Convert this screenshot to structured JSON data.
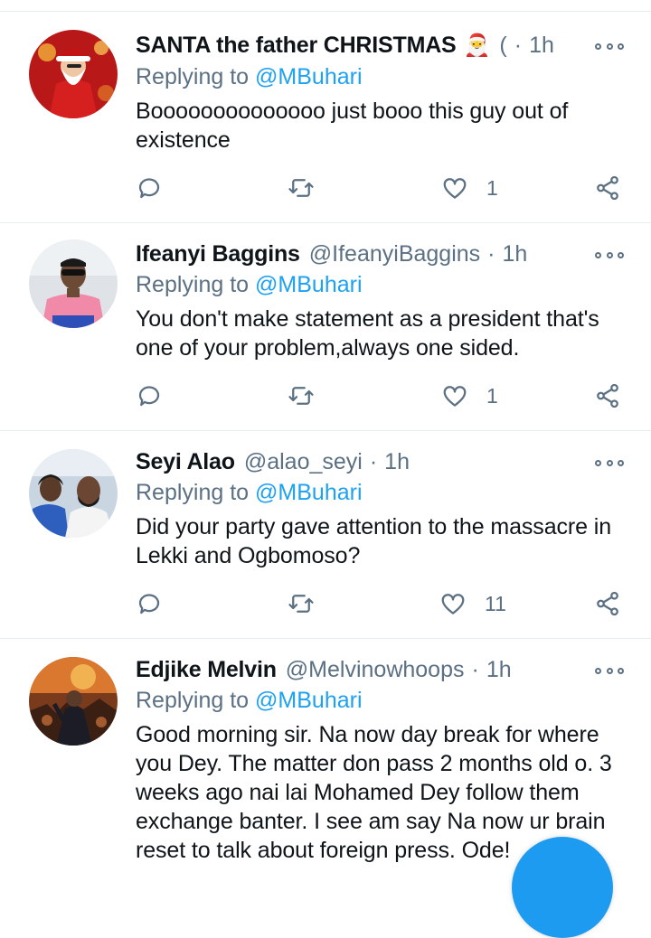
{
  "colors": {
    "accent": "#1da1f2",
    "secondary_text": "#5b7083",
    "divider": "#e6ecf0"
  },
  "replies": [
    {
      "name": "SANTA the father CHRISTMAS",
      "emoji": "🎅",
      "handle": "(",
      "time": "1h",
      "replying_prefix": "Replying to",
      "replying_to": "@MBuhari",
      "text": "Boooooooooooooo just booo this guy out of existence",
      "like_count": "1",
      "avatar_icon": "santa-avatar"
    },
    {
      "name": "Ifeanyi Baggins",
      "emoji": "",
      "handle": "@IfeanyiBaggins",
      "time": "1h",
      "replying_prefix": "Replying to",
      "replying_to": "@MBuhari",
      "text": "You don't make statement as a president that's one of your problem,always one sided.",
      "like_count": "1",
      "avatar_icon": "man-pink-shirt-avatar"
    },
    {
      "name": "Seyi Alao",
      "emoji": "",
      "handle": "@alao_seyi",
      "time": "1h",
      "replying_prefix": "Replying to",
      "replying_to": "@MBuhari",
      "text": "Did your party gave attention to the massacre in Lekki and Ogbomoso?",
      "like_count": "11",
      "avatar_icon": "couple-avatar"
    },
    {
      "name": "Edjike Melvin",
      "emoji": "",
      "handle": "@Melvinowhoops",
      "time": "1h",
      "replying_prefix": "Replying to",
      "replying_to": "@MBuhari",
      "text": "Good morning sir. Na now day break for where you Dey. The matter don pass 2 months old o. 3 weeks ago nai lai Mohamed Dey follow them exchange banter. I see am say Na now ur brain reset to talk about foreign press. Ode!",
      "like_count": "",
      "avatar_icon": "movie-poster-avatar"
    }
  ]
}
